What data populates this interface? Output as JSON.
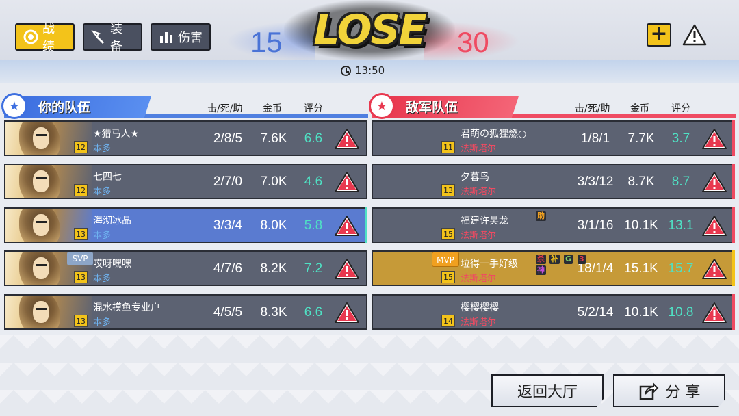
{
  "tabs": [
    {
      "label": "战绩",
      "icon": "record-icon",
      "active": true
    },
    {
      "label": "装备",
      "icon": "equipment-icon",
      "active": false
    },
    {
      "label": "伤害",
      "icon": "damage-chart-icon",
      "active": false
    }
  ],
  "header": {
    "result": "LOSE",
    "blue_kills": "15",
    "red_kills": "30",
    "duration": "13:50"
  },
  "left_team": {
    "title": "你的队伍",
    "col_kda": "击/死/助",
    "col_gold": "金币",
    "col_score": "评分",
    "players": [
      {
        "name": "★猎马人★",
        "hero": "本多",
        "level": "12",
        "kda": "2/8/5",
        "gold": "7.6K",
        "score": "6.6",
        "tag": ""
      },
      {
        "name": "七四七",
        "hero": "本多",
        "level": "12",
        "kda": "2/7/0",
        "gold": "7.0K",
        "score": "4.6",
        "tag": ""
      },
      {
        "name": "海沏冰晶",
        "hero": "本多",
        "level": "13",
        "kda": "3/3/4",
        "gold": "8.0K",
        "score": "5.8",
        "tag": ""
      },
      {
        "name": "哎呀嘿嘿",
        "hero": "本多",
        "level": "13",
        "kda": "4/7/6",
        "gold": "8.2K",
        "score": "7.2",
        "tag": "SVP"
      },
      {
        "name": "混水摸鱼专业户",
        "hero": "本多",
        "level": "13",
        "kda": "4/5/5",
        "gold": "8.3K",
        "score": "6.6",
        "tag": ""
      }
    ]
  },
  "right_team": {
    "title": "敌军队伍",
    "col_kda": "击/死/助",
    "col_gold": "金币",
    "col_score": "评分",
    "players": [
      {
        "name": "君萌の狐狸燃○",
        "hero": "法斯塔尔",
        "level": "11",
        "kda": "1/8/1",
        "gold": "7.7K",
        "score": "3.7",
        "tag": ""
      },
      {
        "name": "夕暮鸟",
        "hero": "法斯塔尔",
        "level": "13",
        "kda": "3/3/12",
        "gold": "8.7K",
        "score": "8.7",
        "tag": ""
      },
      {
        "name": "福建许昊龙",
        "hero": "法斯塔尔",
        "level": "15",
        "kda": "3/1/16",
        "gold": "10.1K",
        "score": "13.1",
        "tag": "",
        "badges": [
          "助"
        ]
      },
      {
        "name": "垃得一手好级",
        "hero": "法斯塔尔",
        "level": "15",
        "kda": "18/1/4",
        "gold": "15.1K",
        "score": "15.7",
        "tag": "MVP",
        "badges": [
          "杀",
          "补",
          "G",
          "3",
          "神"
        ]
      },
      {
        "name": "樱樱樱樱",
        "hero": "法斯塔尔",
        "level": "14",
        "kda": "5/2/14",
        "gold": "10.1K",
        "score": "10.8",
        "tag": ""
      }
    ]
  },
  "buttons": {
    "back": "返回大厅",
    "share": "分 享"
  },
  "colors": {
    "accent": "#f3c31a",
    "blue_team": "#4f7fe0",
    "red_team": "#ef4b62",
    "score_text": "#4fe1c4"
  }
}
